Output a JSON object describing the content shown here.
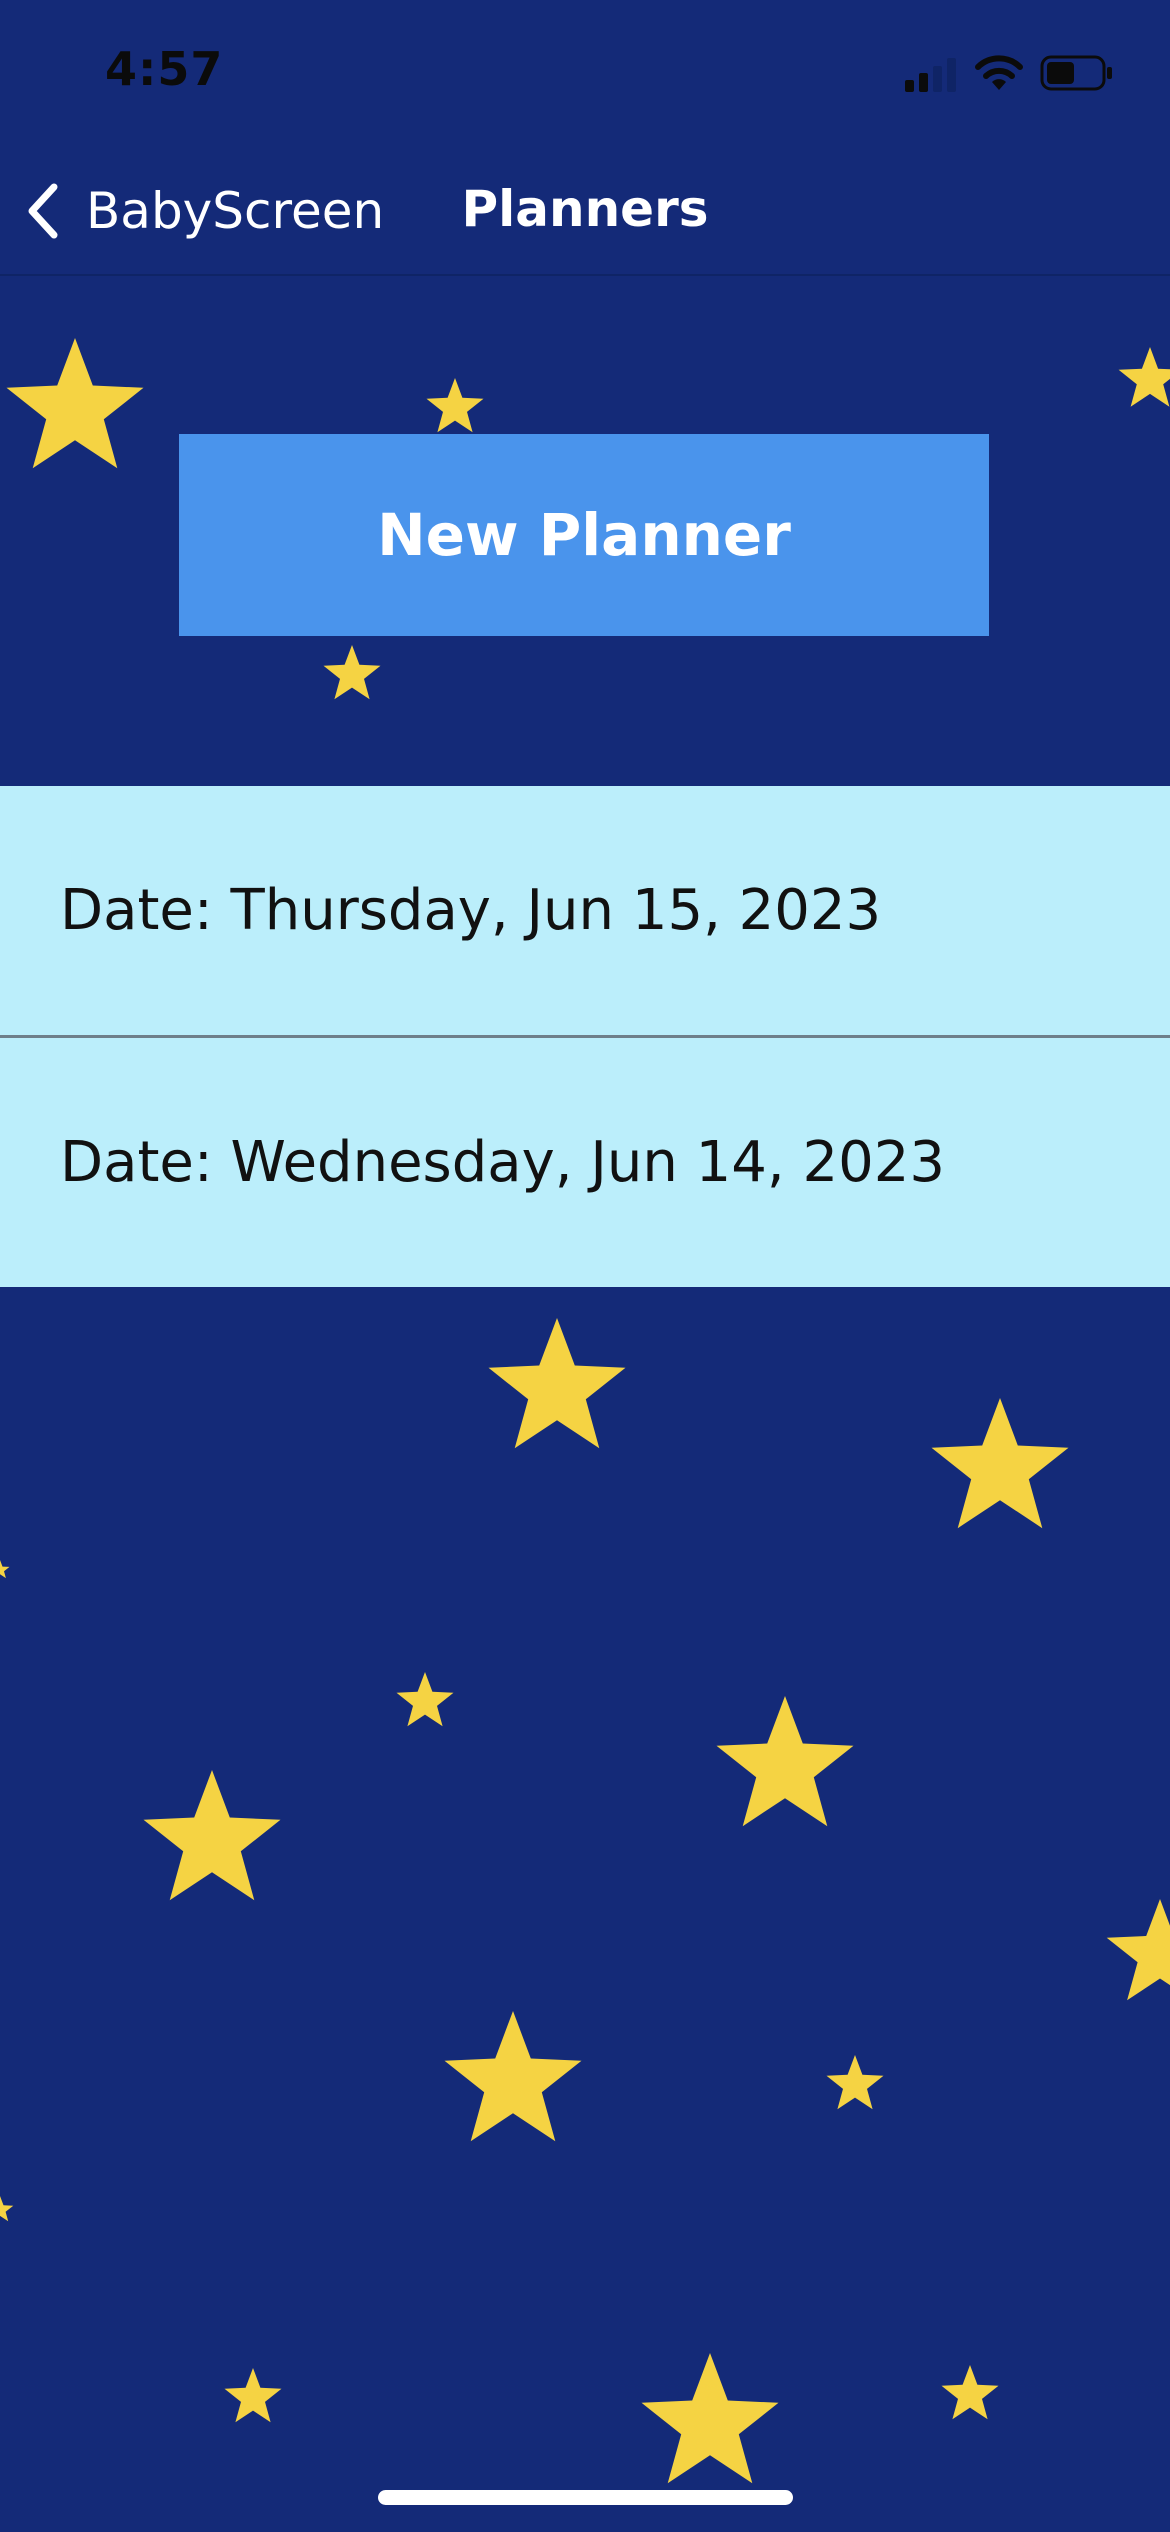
{
  "status_bar": {
    "time": "4:57",
    "icons": [
      "cellular-signal-icon",
      "wifi-icon",
      "battery-icon"
    ]
  },
  "nav_bar": {
    "back_label": "BabyScreen",
    "title": "Planners"
  },
  "actions": {
    "new_planner_label": "New Planner"
  },
  "planners": [
    {
      "label": "Date: Thursday, Jun 15, 2023"
    },
    {
      "label": "Date: Wednesday, Jun 14, 2023"
    }
  ],
  "colors": {
    "background": "#142a78",
    "star": "#f5d343",
    "button": "#4a94ec",
    "row": "#bbeefb"
  }
}
